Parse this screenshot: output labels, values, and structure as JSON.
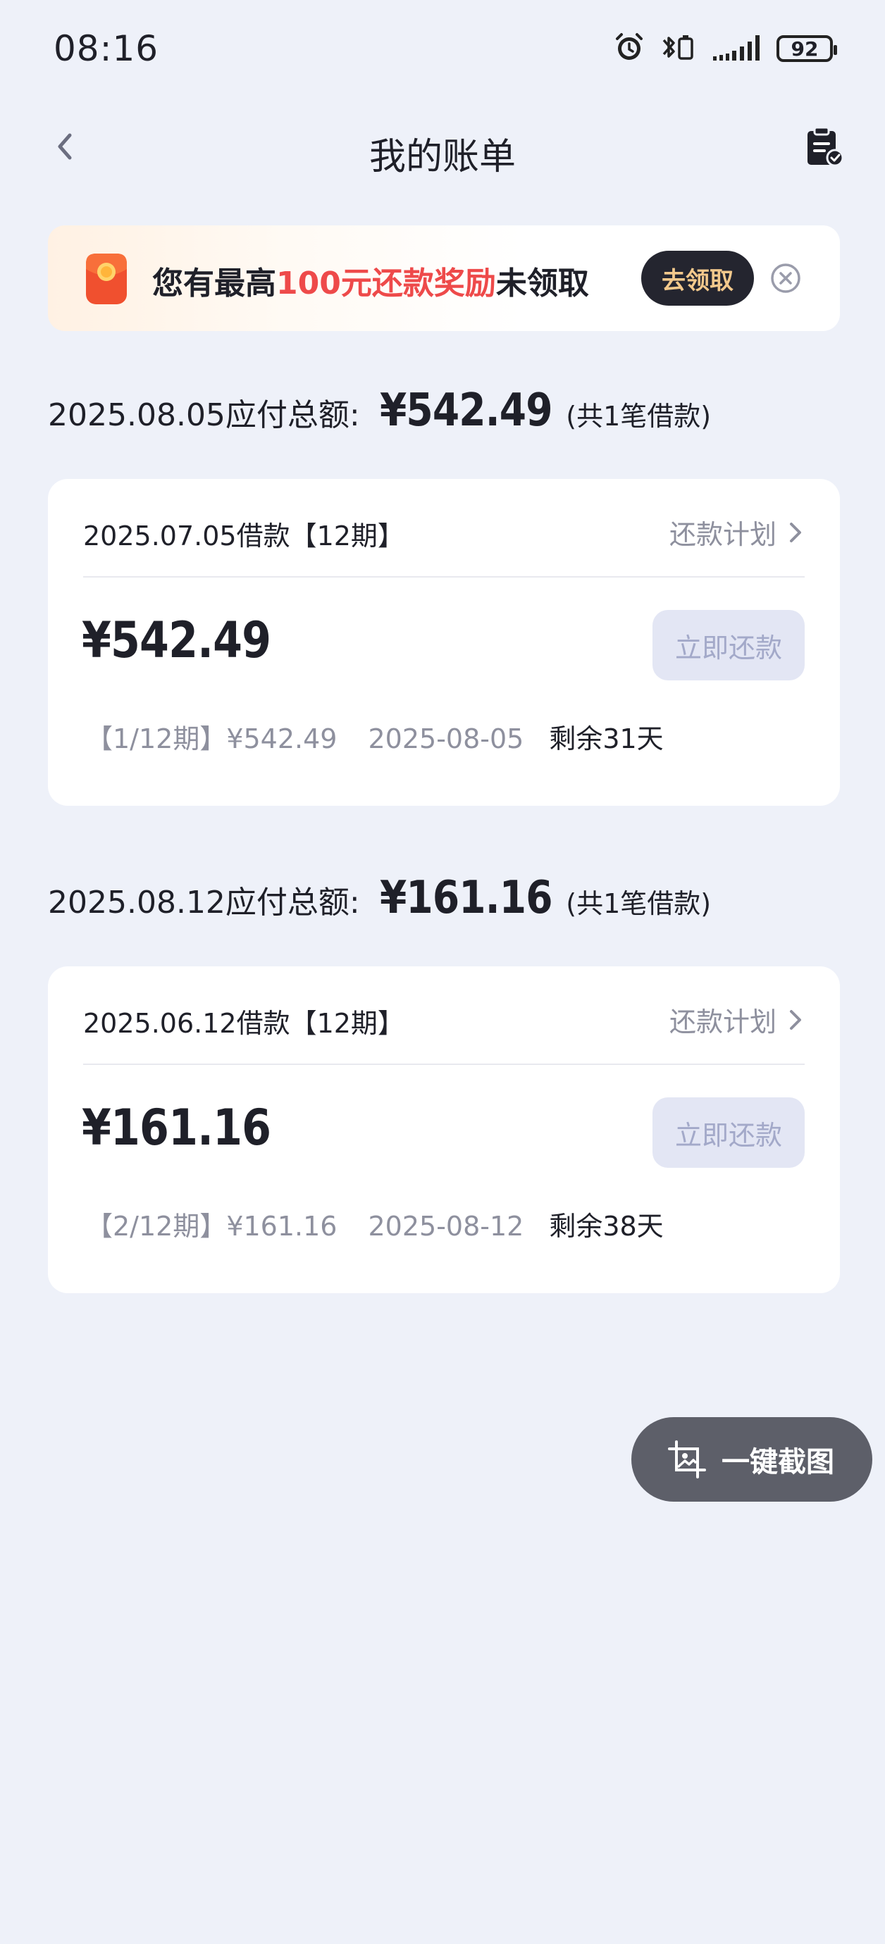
{
  "status_bar": {
    "time": "08:16",
    "battery": "92"
  },
  "header": {
    "title": "我的账单"
  },
  "promo": {
    "text_prefix": "您有最高",
    "text_highlight": "100元还款奖励",
    "text_suffix": "未领取",
    "claim_label": "去领取"
  },
  "bills": [
    {
      "due_label": "2025.08.05应付总额:",
      "total": "¥542.49",
      "count": "(共1笔借款)",
      "loan_title": "2025.07.05借款【12期】",
      "plan_label": "还款计划",
      "amount": "¥542.49",
      "pay_label": "立即还款",
      "period": "【1/12期】¥542.49",
      "due_date": "2025-08-05",
      "remaining": "剩余31天"
    },
    {
      "due_label": "2025.08.12应付总额:",
      "total": "¥161.16",
      "count": "(共1笔借款)",
      "loan_title": "2025.06.12借款【12期】",
      "plan_label": "还款计划",
      "amount": "¥161.16",
      "pay_label": "立即还款",
      "period": "【2/12期】¥161.16",
      "due_date": "2025-08-12",
      "remaining": "剩余38天"
    }
  ],
  "floating": {
    "screenshot_label": "一键截图"
  },
  "icons": {
    "back": "chevron-left-icon",
    "bill_list": "clipboard-check-icon",
    "promo": "red-envelope-icon",
    "close": "close-circle-icon",
    "plan_arrow": "chevron-right-icon",
    "screenshot": "image-crop-icon",
    "alarm": "alarm-icon",
    "bluetooth": "bluetooth-icon",
    "signal": "signal-icon"
  },
  "colors": {
    "accent_red": "#ee4a4a",
    "background": "#eef1f9",
    "claim_text": "#f3c98c"
  }
}
